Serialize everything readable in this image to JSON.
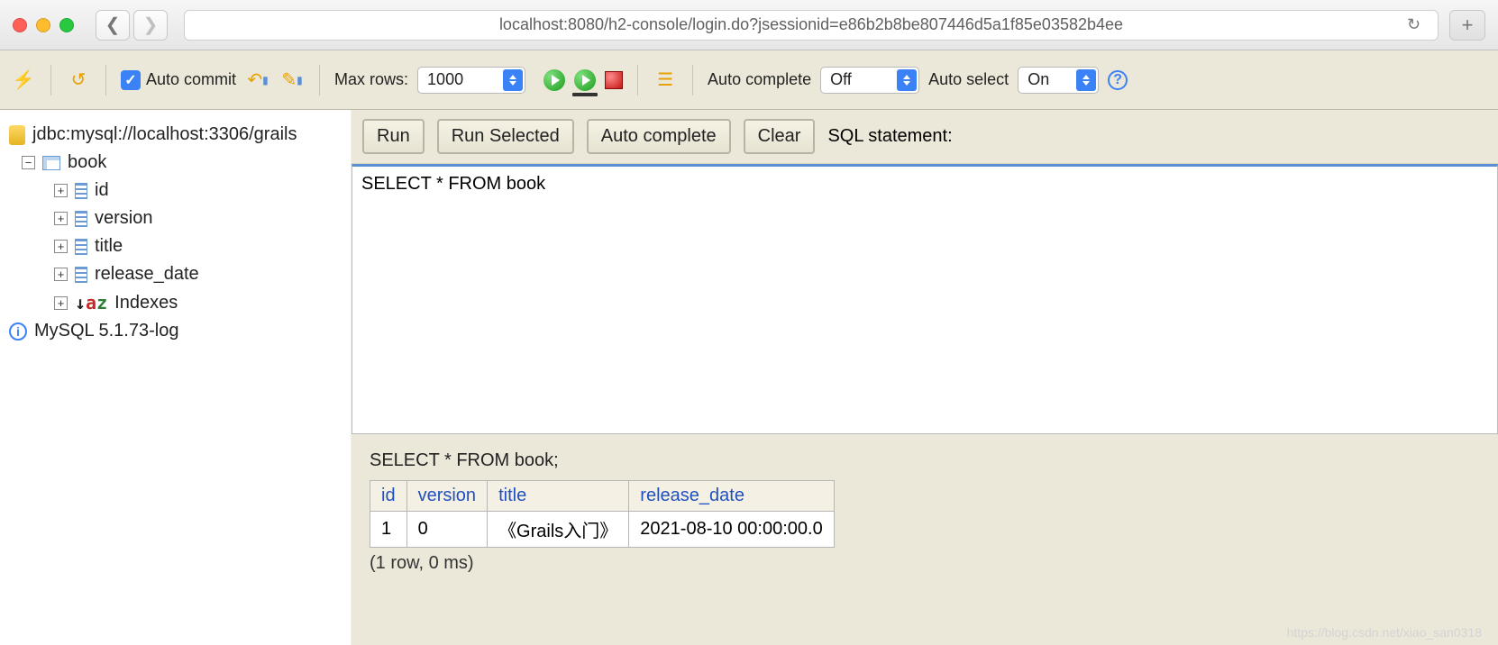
{
  "browser": {
    "url": "localhost:8080/h2-console/login.do?jsessionid=e86b2b8be807446d5a1f85e03582b4ee"
  },
  "toolbar": {
    "auto_commit_label": "Auto commit",
    "max_rows_label": "Max rows:",
    "max_rows_value": "1000",
    "auto_complete_label": "Auto complete",
    "auto_complete_value": "Off",
    "auto_select_label": "Auto select",
    "auto_select_value": "On"
  },
  "sidebar": {
    "jdbc_url": "jdbc:mysql://localhost:3306/grails",
    "table_name": "book",
    "columns": [
      "id",
      "version",
      "title",
      "release_date"
    ],
    "indexes_label": "Indexes",
    "db_info": "MySQL 5.1.73-log"
  },
  "query": {
    "run_label": "Run",
    "run_selected_label": "Run Selected",
    "auto_complete_label": "Auto complete",
    "clear_label": "Clear",
    "sql_statement_label": "SQL statement:",
    "sql_text": "SELECT * FROM book "
  },
  "result": {
    "statement": "SELECT * FROM book;",
    "headers": [
      "id",
      "version",
      "title",
      "release_date"
    ],
    "rows": [
      {
        "id": "1",
        "version": "0",
        "title": "《Grails入门》",
        "release_date": "2021-08-10 00:00:00.0"
      }
    ],
    "meta": "(1 row, 0 ms)"
  },
  "watermark": "https://blog.csdn.net/xiao_san0318"
}
